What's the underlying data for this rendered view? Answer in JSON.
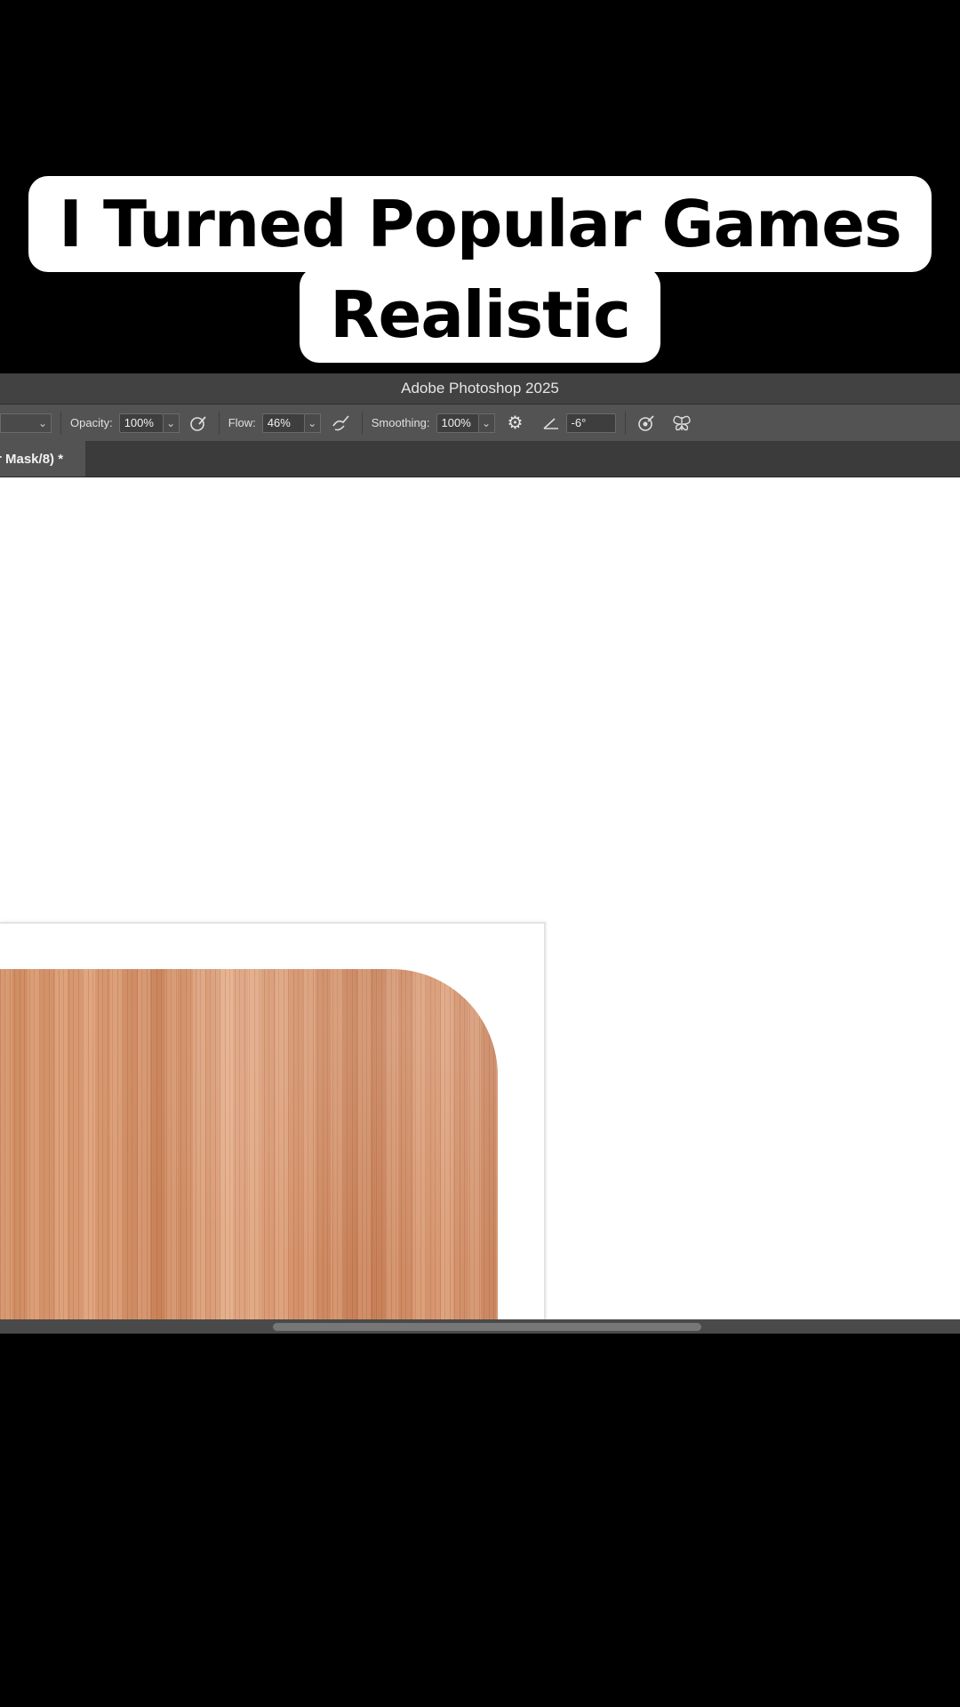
{
  "caption": {
    "line1": "I Turned Popular Games",
    "line2": "Realistic"
  },
  "photoshop": {
    "window_title": "Adobe Photoshop 2025",
    "options": {
      "opacity_label": "Opacity:",
      "opacity_value": "100%",
      "flow_label": "Flow:",
      "flow_value": "46%",
      "smoothing_label": "Smoothing:",
      "smoothing_value": "100%",
      "angle_value": "-6°"
    },
    "document_tab": "r Mask/8) *"
  },
  "icons": [
    "chevron-down-icon",
    "pressure-opacity-icon",
    "airbrush-icon",
    "gear-icon",
    "angle-icon",
    "pressure-size-icon",
    "symmetry-butterfly-icon"
  ]
}
